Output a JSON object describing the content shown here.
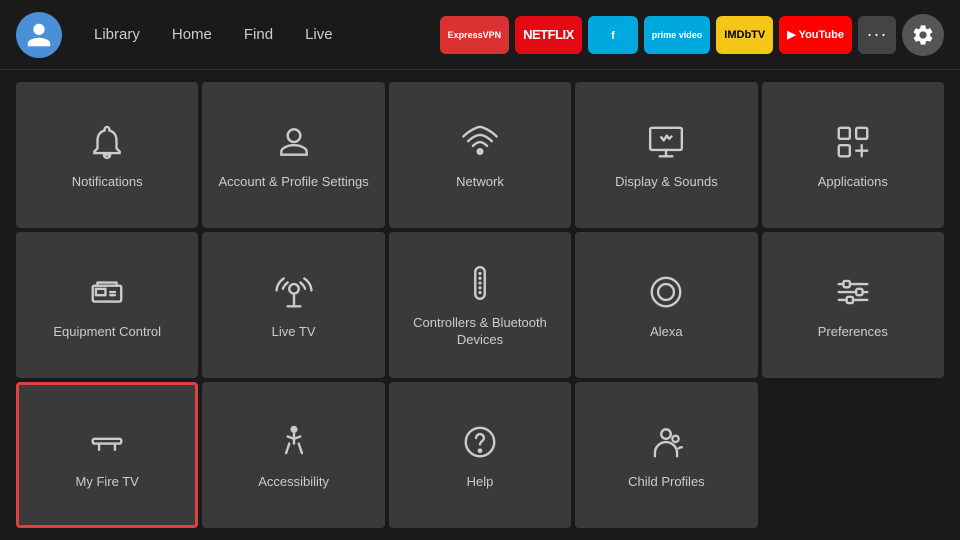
{
  "topbar": {
    "nav": [
      {
        "label": "Library",
        "id": "library"
      },
      {
        "label": "Home",
        "id": "home"
      },
      {
        "label": "Find",
        "id": "find"
      },
      {
        "label": "Live",
        "id": "live"
      }
    ],
    "apps": [
      {
        "label": "ExpressVPN",
        "class": "expressvpn",
        "id": "expressvpn"
      },
      {
        "label": "NETFLIX",
        "class": "netflix",
        "id": "netflix"
      },
      {
        "label": "f",
        "class": "freevee",
        "id": "freevee"
      },
      {
        "label": "prime video",
        "class": "primevideo",
        "id": "primevideo"
      },
      {
        "label": "IMDbTV",
        "class": "imdb",
        "id": "imdb"
      },
      {
        "label": "▶ YouTube",
        "class": "youtube",
        "id": "youtube"
      }
    ],
    "more_label": "···",
    "settings_label": "Settings"
  },
  "grid": {
    "items": [
      {
        "id": "notifications",
        "label": "Notifications",
        "icon": "bell",
        "selected": false
      },
      {
        "id": "account",
        "label": "Account & Profile Settings",
        "icon": "person",
        "selected": false
      },
      {
        "id": "network",
        "label": "Network",
        "icon": "wifi",
        "selected": false
      },
      {
        "id": "display-sounds",
        "label": "Display & Sounds",
        "icon": "display",
        "selected": false
      },
      {
        "id": "applications",
        "label": "Applications",
        "icon": "apps",
        "selected": false
      },
      {
        "id": "equipment-control",
        "label": "Equipment Control",
        "icon": "equipment",
        "selected": false
      },
      {
        "id": "live-tv",
        "label": "Live TV",
        "icon": "antenna",
        "selected": false
      },
      {
        "id": "controllers",
        "label": "Controllers & Bluetooth Devices",
        "icon": "remote",
        "selected": false
      },
      {
        "id": "alexa",
        "label": "Alexa",
        "icon": "alexa",
        "selected": false
      },
      {
        "id": "preferences",
        "label": "Preferences",
        "icon": "sliders",
        "selected": false
      },
      {
        "id": "my-fire-tv",
        "label": "My Fire TV",
        "icon": "firetv",
        "selected": true
      },
      {
        "id": "accessibility",
        "label": "Accessibility",
        "icon": "accessibility",
        "selected": false
      },
      {
        "id": "help",
        "label": "Help",
        "icon": "help",
        "selected": false
      },
      {
        "id": "child-profiles",
        "label": "Child Profiles",
        "icon": "child",
        "selected": false
      }
    ]
  }
}
